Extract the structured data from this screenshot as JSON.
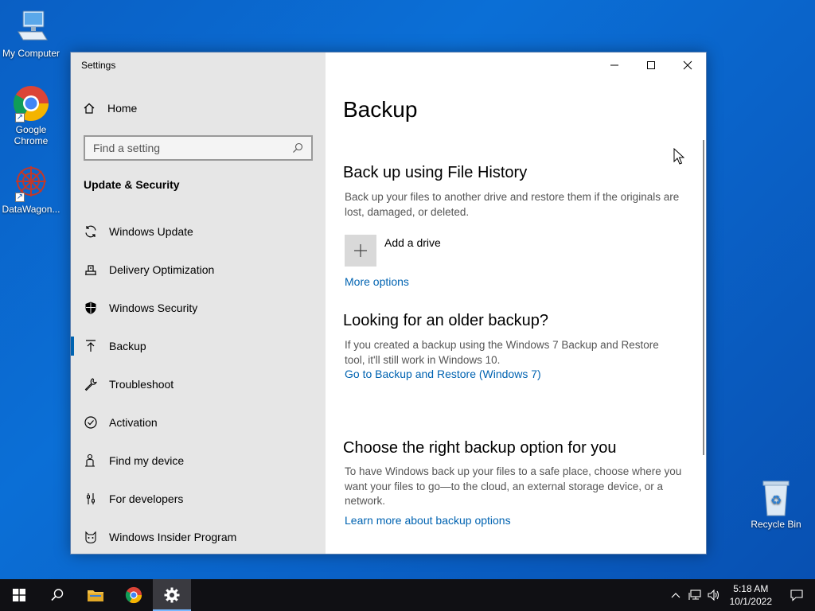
{
  "desktop": {
    "icons": [
      {
        "label": "My Computer"
      },
      {
        "label": "Google Chrome"
      },
      {
        "label": "DataWagon..."
      },
      {
        "label": "Recycle Bin"
      }
    ]
  },
  "window": {
    "title": "Settings",
    "sidebar": {
      "home_label": "Home",
      "search_placeholder": "Find a setting",
      "section_title": "Update & Security",
      "items": [
        {
          "label": "Windows Update",
          "icon": "sync-icon"
        },
        {
          "label": "Delivery Optimization",
          "icon": "delivery-optimization-icon"
        },
        {
          "label": "Windows Security",
          "icon": "shield-icon"
        },
        {
          "label": "Backup",
          "icon": "backup-arrow-icon",
          "active": true
        },
        {
          "label": "Troubleshoot",
          "icon": "wrench-icon"
        },
        {
          "label": "Activation",
          "icon": "check-circle-icon"
        },
        {
          "label": "Find my device",
          "icon": "person-locate-icon"
        },
        {
          "label": "For developers",
          "icon": "developer-sliders-icon"
        },
        {
          "label": "Windows Insider Program",
          "icon": "insider-cat-icon"
        }
      ]
    },
    "content": {
      "page_title": "Backup",
      "file_history": {
        "heading": "Back up using File History",
        "description": "Back up your files to another drive and restore them if the originals are lost, damaged, or deleted.",
        "add_drive_label": "Add a drive",
        "more_options_link": "More options"
      },
      "older_backup": {
        "heading": "Looking for an older backup?",
        "description": "If you created a backup using the Windows 7 Backup and Restore tool, it'll still work in Windows 10.",
        "link": "Go to Backup and Restore (Windows 7)"
      },
      "right_option": {
        "heading": "Choose the right backup option for you",
        "description": "To have Windows back up your files to a safe place, choose where you want your files to go—to the cloud, an external storage device, or a network.",
        "link": "Learn more about backup options"
      }
    }
  },
  "taskbar": {
    "time": "5:18 AM",
    "date": "10/1/2022"
  },
  "colors": {
    "accent": "#0063b1",
    "desktop": "#0b6fd6",
    "taskbar": "#101014"
  }
}
